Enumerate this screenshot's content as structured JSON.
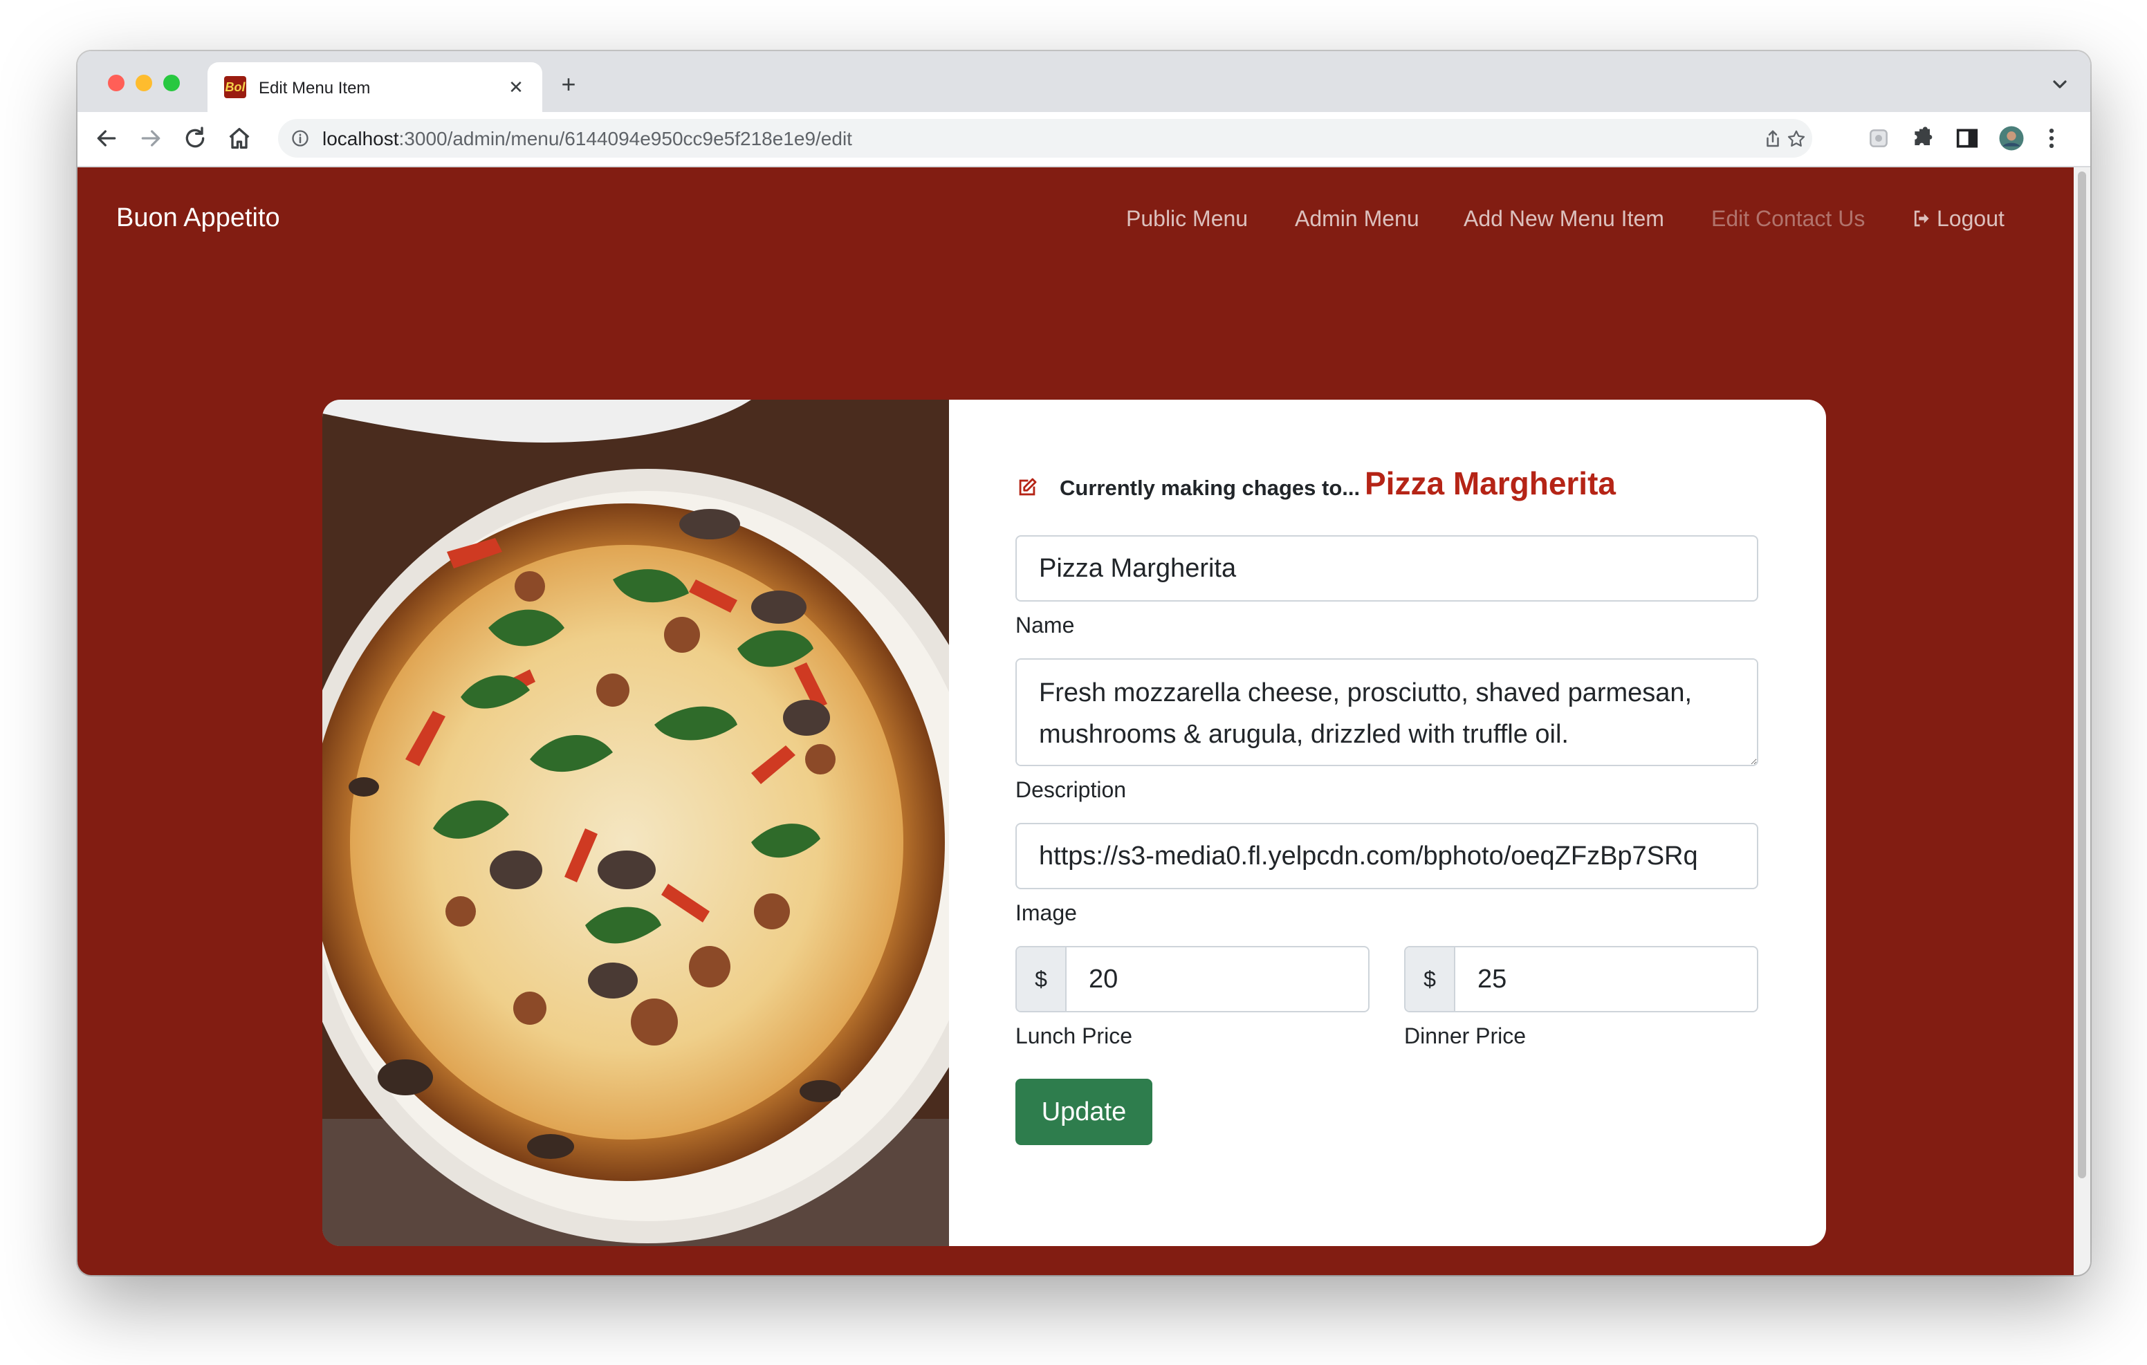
{
  "browser": {
    "tab_title": "Edit Menu Item",
    "tab_favicon_text": "Bol",
    "url_host": "localhost",
    "url_path": ":3000/admin/menu/6144094e950cc9e5f218e1e9/edit"
  },
  "navbar": {
    "brand": "Buon Appetito",
    "links": [
      "Public Menu",
      "Admin Menu",
      "Add New Menu Item",
      "Edit Contact Us",
      "Logout"
    ]
  },
  "form": {
    "heading_prefix": "Currently making chages to...",
    "heading_item": "Pizza Margherita",
    "name_value": "Pizza Margherita",
    "name_label": "Name",
    "description_value": "Fresh mozzarella cheese, prosciutto, shaved parmesan, mushrooms & arugula, drizzled with truffle oil.",
    "description_label": "Description",
    "image_value": "https://s3-media0.fl.yelpcdn.com/bphoto/oeqZFzBp7SRq",
    "image_label": "Image",
    "currency_symbol": "$",
    "lunch_price": "20",
    "lunch_label": "Lunch Price",
    "dinner_price": "25",
    "dinner_label": "Dinner Price",
    "submit_label": "Update"
  },
  "colors": {
    "page_background": "#821d12",
    "accent_text": "#b52416",
    "button": "#2e7d4d"
  }
}
